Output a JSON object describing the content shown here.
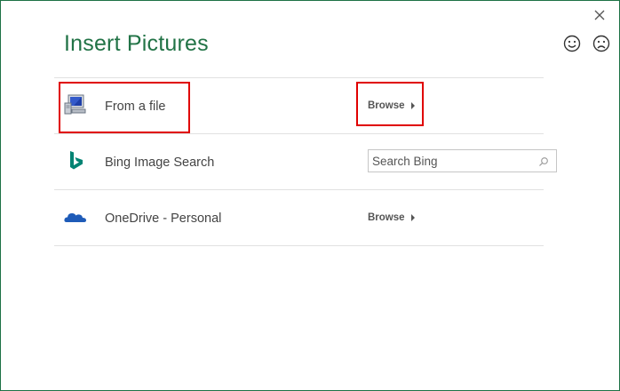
{
  "dialog": {
    "title": "Insert Pictures",
    "close_icon": "close-icon",
    "feedback": {
      "smile_icon": "smile-icon",
      "frown_icon": "frown-icon"
    }
  },
  "sources": [
    {
      "label": "From a file",
      "icon": "computer-icon",
      "action_label": "Browse"
    },
    {
      "label": "Bing Image Search",
      "icon": "bing-icon",
      "search_placeholder": "Search Bing"
    },
    {
      "label": "OneDrive - Personal",
      "icon": "onedrive-icon",
      "action_label": "Browse"
    }
  ],
  "colors": {
    "accent": "#217346",
    "highlight": "#e00000",
    "onedrive_blue": "#1e5bb8",
    "bing_teal": "#008373"
  }
}
